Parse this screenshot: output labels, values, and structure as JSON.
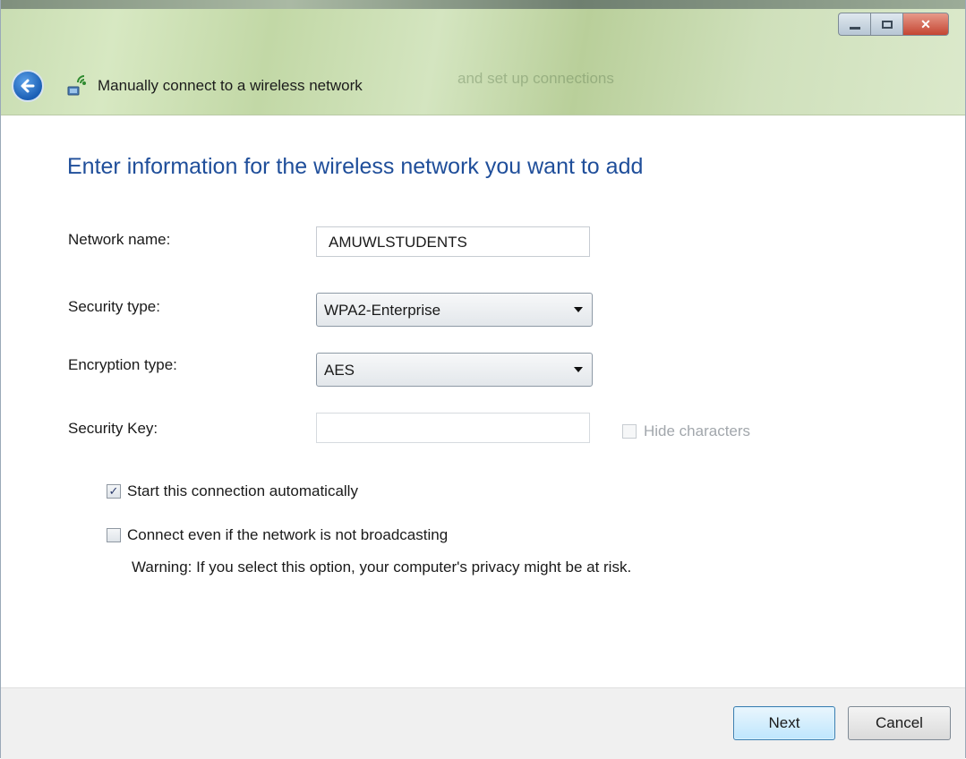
{
  "window": {
    "title": "Manually connect to a wireless network",
    "background_title_ghost": "and set up connections",
    "caption_buttons": {
      "minimize": "minimize-icon",
      "maximize": "maximize-icon",
      "close": "close-icon"
    }
  },
  "heading": "Enter information for the wireless network you want to add",
  "form": {
    "network_name": {
      "label": "Network name:",
      "value": "AMUWLSTUDENTS"
    },
    "security_type": {
      "label": "Security type:",
      "value": "WPA2-Enterprise"
    },
    "encryption_type": {
      "label": "Encryption type:",
      "value": "AES"
    },
    "security_key": {
      "label": "Security Key:",
      "value": "",
      "hide_label": "Hide characters",
      "hide_checked": false,
      "disabled": true
    }
  },
  "options": {
    "start_auto": {
      "label": "Start this connection automatically",
      "checked": true
    },
    "connect_hidden": {
      "label": "Connect even if the network is not broadcasting",
      "checked": false
    },
    "warning": "Warning: If you select this option, your computer's privacy might be at risk."
  },
  "buttons": {
    "next": "Next",
    "cancel": "Cancel"
  },
  "colors": {
    "heading": "#1f4e9a",
    "default_button_border": "#3c7fb1"
  }
}
